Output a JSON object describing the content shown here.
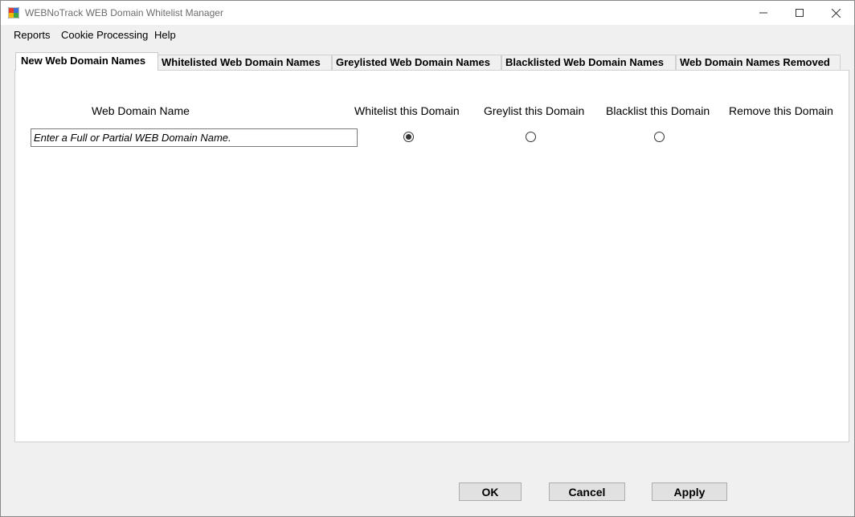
{
  "window": {
    "title": "WEBNoTrack WEB Domain Whitelist Manager",
    "icons": {
      "app": "app-icon",
      "minimize": "minimize-icon",
      "maximize": "maximize-icon",
      "close": "close-icon"
    }
  },
  "menu": {
    "items": [
      {
        "label": "Reports"
      },
      {
        "label": "Cookie Processing"
      },
      {
        "label": "Help"
      }
    ]
  },
  "tabs": [
    {
      "label": "New Web Domain Names",
      "active": true
    },
    {
      "label": "Whitelisted Web Domain Names",
      "active": false
    },
    {
      "label": "Greylisted Web Domain Names",
      "active": false
    },
    {
      "label": "Blacklisted Web Domain Names",
      "active": false
    },
    {
      "label": "Web Domain Names Removed",
      "active": false
    }
  ],
  "panel": {
    "headers": {
      "name": "Web Domain Name",
      "whitelist": "Whitelist this Domain",
      "greylist": "Greylist this Domain",
      "blacklist": "Blacklist this Domain",
      "remove": "Remove this Domain"
    },
    "domain_input": {
      "value": "",
      "placeholder": "Enter a Full or Partial WEB Domain Name."
    },
    "selected_option": "whitelist"
  },
  "buttons": {
    "ok": "OK",
    "cancel": "Cancel",
    "apply": "Apply"
  },
  "colors": {
    "window_bg": "#f0f0f0",
    "panel_bg": "#ffffff",
    "button_bg": "#e1e1e1",
    "border": "#adadad"
  }
}
